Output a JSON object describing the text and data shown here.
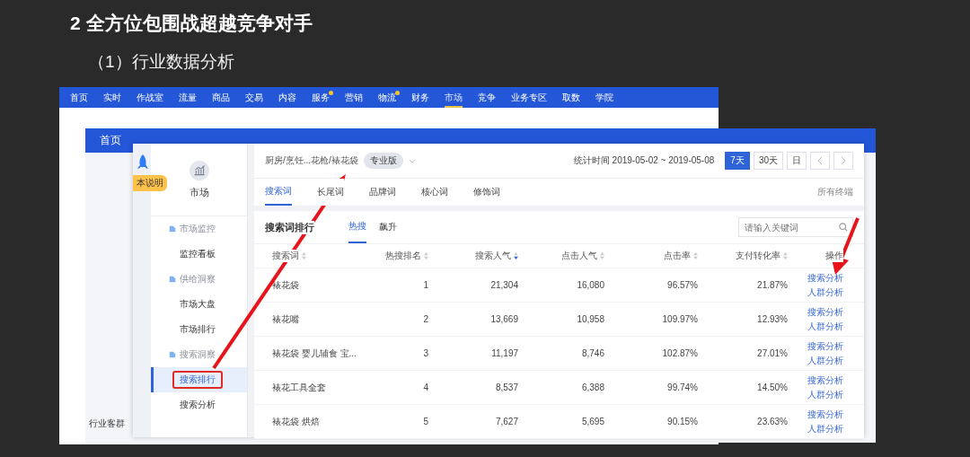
{
  "slide": {
    "title": "2 全方位包围战超越竞争对手",
    "subtitle": "（1）行业数据分析"
  },
  "back_window": {
    "nav": [
      {
        "label": "首页",
        "dot": false,
        "selected": false
      },
      {
        "label": "实时",
        "dot": false,
        "selected": false
      },
      {
        "label": "作战室",
        "dot": false,
        "selected": false
      },
      {
        "label": "流量",
        "dot": false,
        "selected": false
      },
      {
        "label": "商品",
        "dot": false,
        "selected": false
      },
      {
        "label": "交易",
        "dot": false,
        "selected": false
      },
      {
        "label": "内容",
        "dot": false,
        "selected": false
      },
      {
        "label": "服务",
        "dot": true,
        "selected": false
      },
      {
        "label": "营销",
        "dot": false,
        "selected": false
      },
      {
        "label": "物流",
        "dot": true,
        "selected": false
      },
      {
        "label": "财务",
        "dot": false,
        "selected": false
      },
      {
        "label": "市场",
        "dot": false,
        "selected": true
      },
      {
        "label": "竞争",
        "dot": false,
        "selected": false
      },
      {
        "label": "业务专区",
        "dot": false,
        "selected": false
      },
      {
        "label": "取数",
        "dot": false,
        "selected": false
      },
      {
        "label": "学院",
        "dot": false,
        "selected": false
      }
    ]
  },
  "middle_window": {
    "nav_home": "首页",
    "sidebar_footer": "行业客群"
  },
  "front_window": {
    "guide_badge": "本说明",
    "module": "市场",
    "menu": [
      {
        "kind": "group",
        "label": "市场监控"
      },
      {
        "kind": "item",
        "label": "监控看板",
        "selected": false
      },
      {
        "kind": "group",
        "label": "供给洞察"
      },
      {
        "kind": "item",
        "label": "市场大盘",
        "selected": false
      },
      {
        "kind": "item",
        "label": "市场排行",
        "selected": false
      },
      {
        "kind": "group",
        "label": "搜索洞察"
      },
      {
        "kind": "item",
        "label": "搜索排行",
        "selected": true
      },
      {
        "kind": "item",
        "label": "搜索分析",
        "selected": false
      }
    ],
    "breadcrumb": "厨房/烹饪...花枪/裱花袋",
    "edition": "专业版",
    "period": "统计时间 2019-05-02 ~ 2019-05-08",
    "range_buttons": [
      {
        "label": "7天",
        "selected": true
      },
      {
        "label": "30天",
        "selected": false
      },
      {
        "label": "日",
        "selected": false
      }
    ],
    "tabs": [
      {
        "label": "搜索词",
        "selected": true
      },
      {
        "label": "长尾词",
        "selected": false
      },
      {
        "label": "品牌词",
        "selected": false
      },
      {
        "label": "核心词",
        "selected": false
      },
      {
        "label": "修饰词",
        "selected": false
      }
    ],
    "terminal": "所有终端",
    "card": {
      "title": "搜索词排行",
      "subtabs": [
        {
          "label": "热搜",
          "selected": true
        },
        {
          "label": "飙升",
          "selected": false
        }
      ],
      "search": {
        "placeholder": "请输入关键词"
      }
    },
    "table": {
      "columns": [
        {
          "label": "搜索词",
          "sorted": false
        },
        {
          "label": "热搜排名",
          "sorted": false
        },
        {
          "label": "搜索人气",
          "sorted": true
        },
        {
          "label": "点击人气",
          "sorted": false
        },
        {
          "label": "点击率",
          "sorted": false
        },
        {
          "label": "支付转化率",
          "sorted": false
        },
        {
          "label": "操作"
        }
      ],
      "rows": [
        {
          "cells": [
            "裱花袋",
            "1",
            "21,304",
            "16,080",
            "96.57%",
            "21.87%"
          ],
          "actions": [
            "搜索分析",
            "人群分析"
          ]
        },
        {
          "cells": [
            "裱花嘴",
            "2",
            "13,669",
            "10,958",
            "109.97%",
            "12.93%"
          ],
          "actions": [
            "搜索分析",
            "人群分析"
          ]
        },
        {
          "cells": [
            "裱花袋 婴儿辅食 宝...",
            "3",
            "11,197",
            "8,746",
            "102.87%",
            "27.01%"
          ],
          "actions": [
            "搜索分析",
            "人群分析"
          ]
        },
        {
          "cells": [
            "裱花工具全套",
            "4",
            "8,537",
            "6,388",
            "99.74%",
            "14.50%"
          ],
          "actions": [
            "搜索分析",
            "人群分析"
          ]
        },
        {
          "cells": [
            "裱花袋 烘焙",
            "5",
            "7,627",
            "5,695",
            "90.15%",
            "23.63%"
          ],
          "actions": [
            "搜索分析",
            "人群分析"
          ]
        }
      ]
    }
  }
}
